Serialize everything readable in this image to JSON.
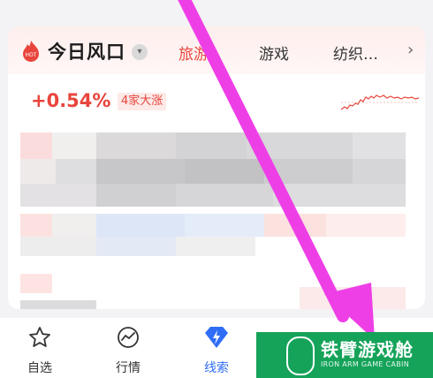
{
  "panel": {
    "title": "今日风口",
    "tabs": [
      "旅游",
      "游戏",
      "纺织…"
    ],
    "active_tab": "旅游",
    "change_percent": "+0.54%",
    "rise_badge": "4家大涨",
    "hot_label": "HOT",
    "accent_color": "#e8453c"
  },
  "bottom_nav": {
    "items": [
      {
        "label": "自选",
        "icon": "star-icon"
      },
      {
        "label": "行情",
        "icon": "market-trend-icon"
      },
      {
        "label": "线索",
        "icon": "lightning-icon"
      }
    ],
    "active": "线索",
    "active_color": "#2f6df6"
  },
  "watermark": {
    "title": "铁臂游戏舱",
    "subtitle": "IRON ARM GAME CABIN",
    "color": "#15a359"
  },
  "annotation": {
    "arrow_color": "#ee3fe6"
  }
}
